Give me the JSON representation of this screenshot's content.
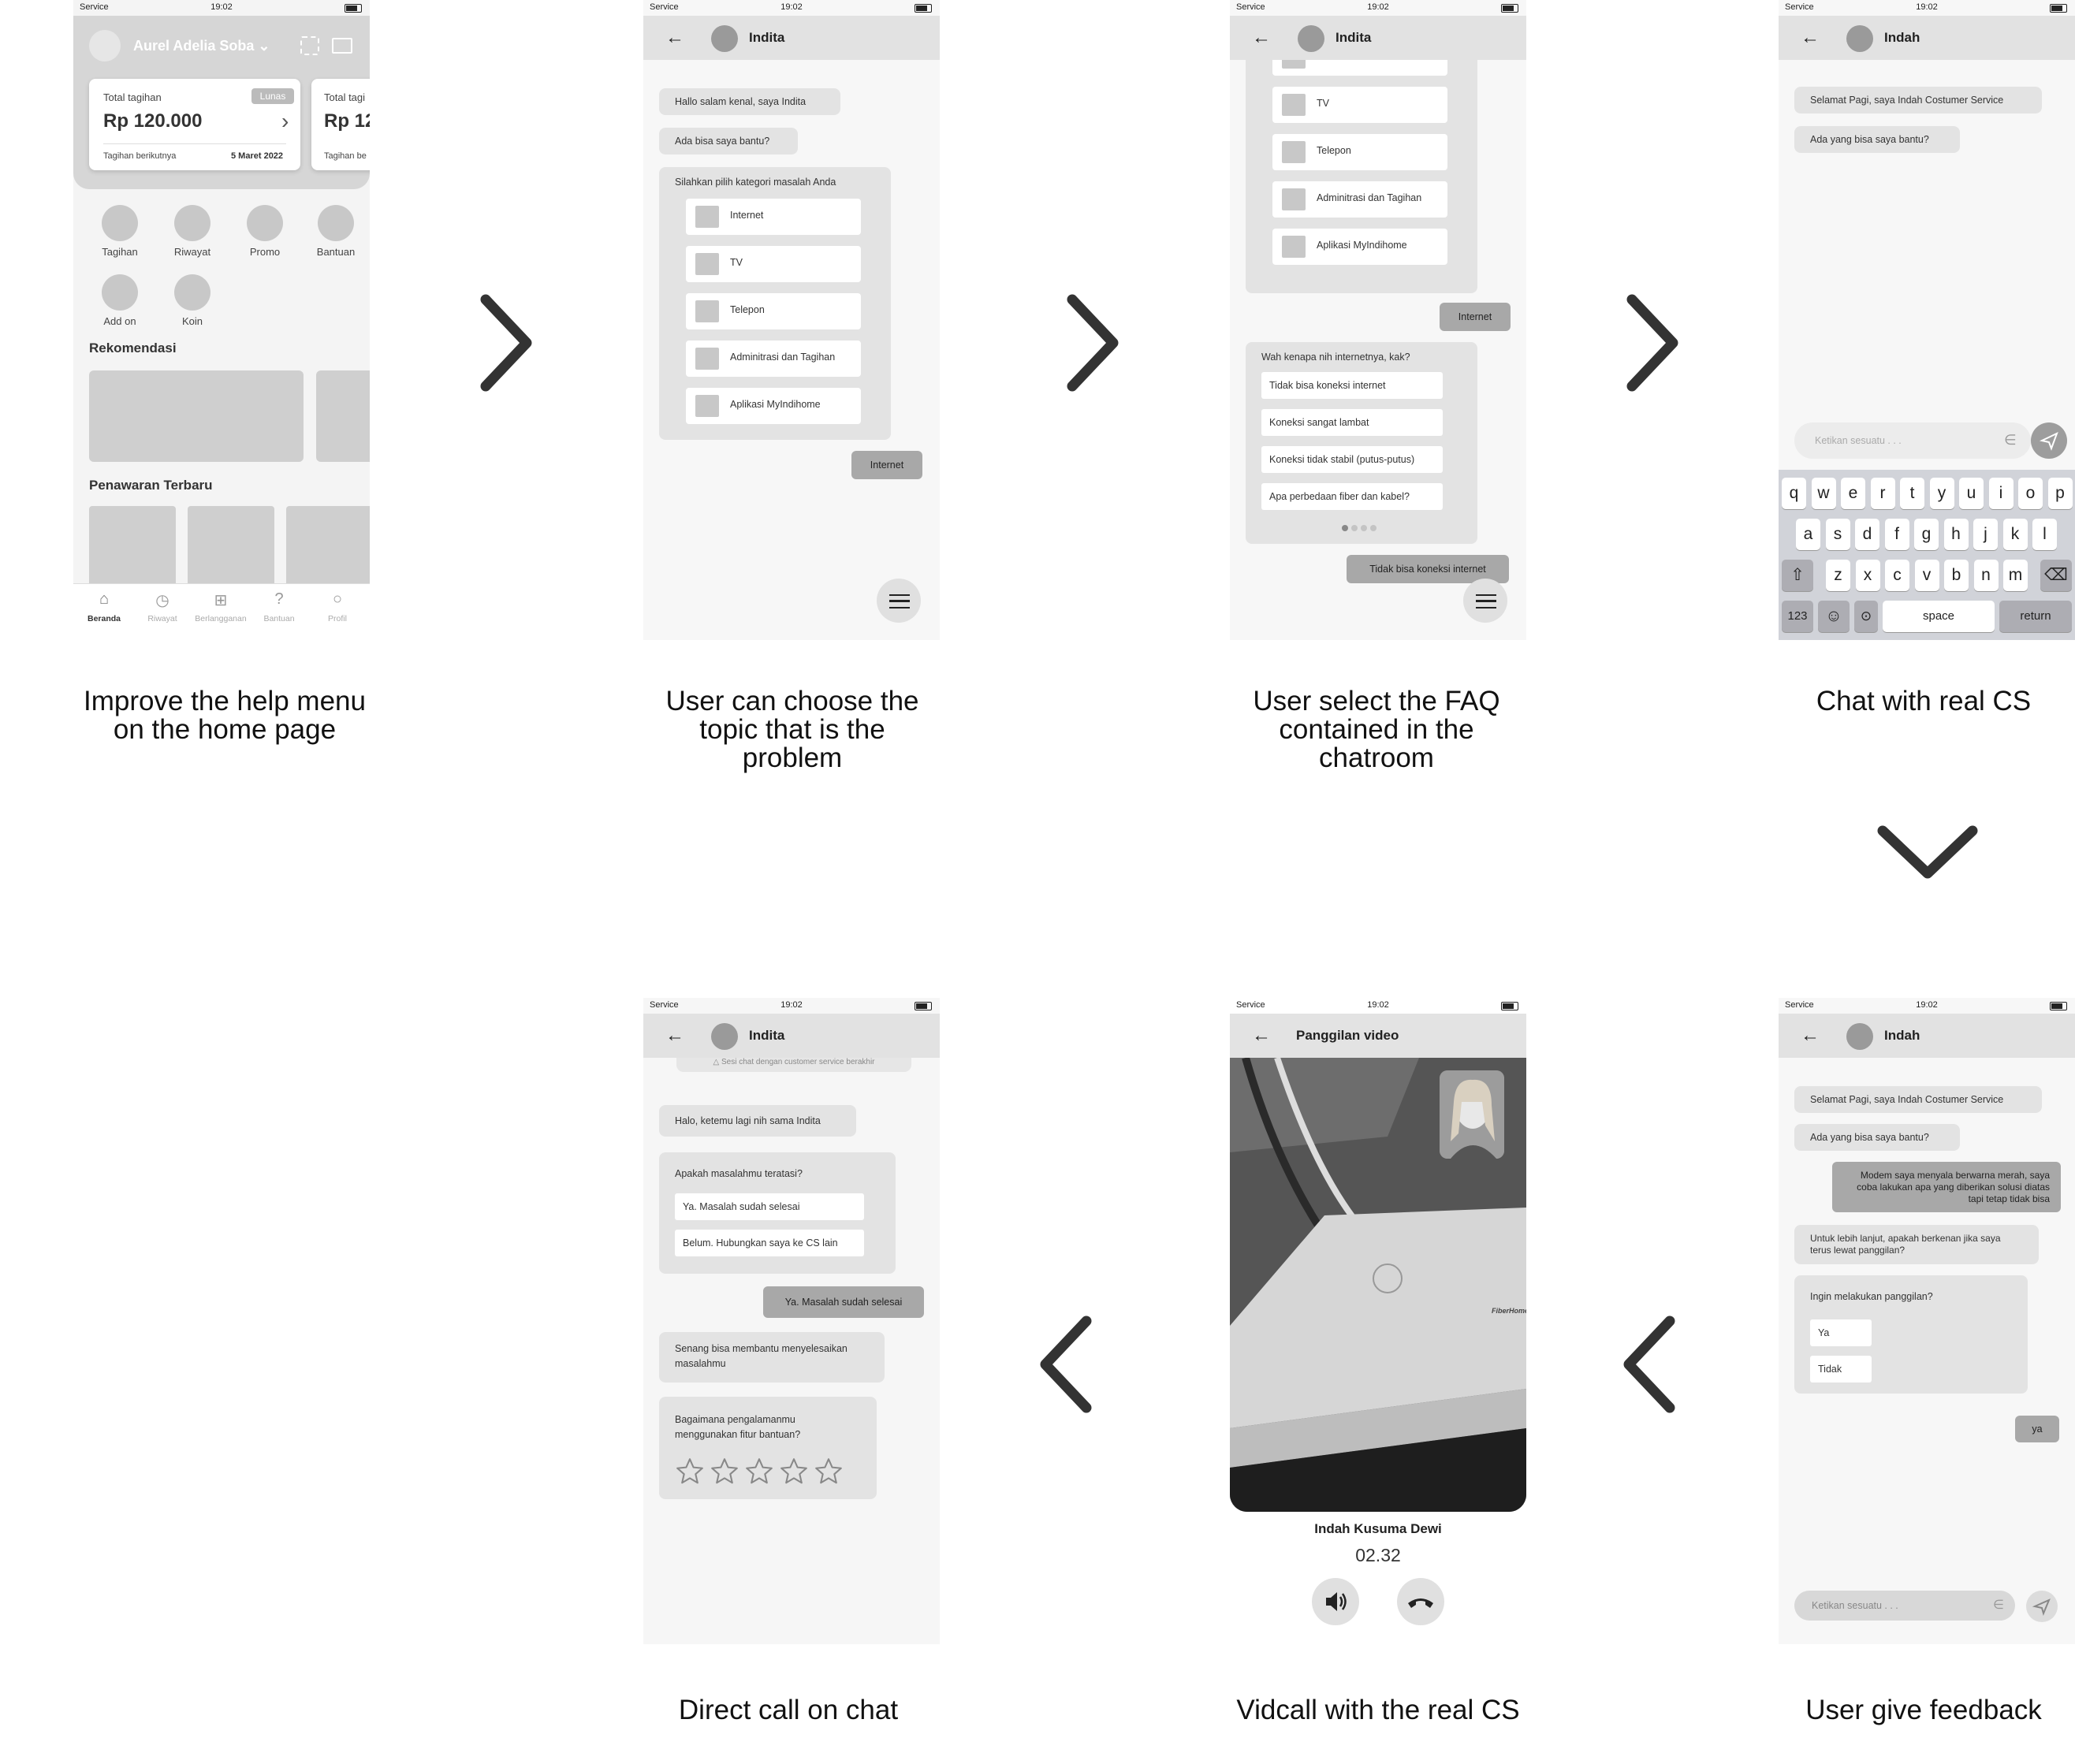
{
  "status": {
    "carrier": "Service",
    "time": "19:02"
  },
  "captions": {
    "s1": "Improve the help menu on the home page",
    "s2": "User can choose the topic that is the problem",
    "s3": "User select the FAQ contained in the chatroom",
    "s4": "Chat with real CS",
    "s5": "Direct call on chat",
    "s6": "Vidcall with the real CS",
    "s7": "User give feedback"
  },
  "home": {
    "user_name": "Aurel Adelia Soba",
    "card_label": "Total tagihan",
    "card_badge": "Lunas",
    "card_amount": "Rp 120.000",
    "card_next_label": "Tagihan berikutnya",
    "card_next_date": "5 Maret 2022",
    "card2_label": "Total tagi",
    "card2_amount": "Rp 12",
    "card2_next": "Tagihan be",
    "menu": [
      "Tagihan",
      "Riwayat",
      "Promo",
      "Bantuan",
      "Add on",
      "Koin"
    ],
    "section_reco": "Rekomendasi",
    "section_offer": "Penawaran Terbaru",
    "nav": [
      "Beranda",
      "Riwayat",
      "Berlangganan",
      "Bantuan",
      "Profil"
    ]
  },
  "chat_indita": {
    "agent": "Indita",
    "greet": "Hallo salam kenal, saya Indita",
    "ask": "Ada bisa saya bantu?",
    "category_prompt": "Silahkan pilih kategori masalah Anda",
    "categories": [
      "Internet",
      "TV",
      "Telepon",
      "Adminitrasi dan Tagihan",
      "Aplikasi MyIndihome"
    ],
    "user_pick": "Internet"
  },
  "chat_faq": {
    "agent": "Indita",
    "categories": [
      "Internet",
      "TV",
      "Telepon",
      "Adminitrasi dan Tagihan",
      "Aplikasi MyIndihome"
    ],
    "user_pick": "Internet",
    "faq_prompt": "Wah kenapa nih internetnya, kak?",
    "faqs": [
      "Tidak bisa koneksi internet",
      "Koneksi sangat lambat",
      "Koneksi tidak stabil (putus-putus)",
      "Apa perbedaan fiber dan kabel?"
    ],
    "user_faq": "Tidak bisa koneksi internet"
  },
  "chat_cs": {
    "agent": "Indah",
    "greet": "Selamat Pagi, saya Indah Costumer Service",
    "ask": "Ada yang bisa saya bantu?",
    "input_placeholder": "Ketikan sesuatu . . .",
    "row1": [
      "q",
      "w",
      "e",
      "r",
      "t",
      "y",
      "u",
      "i",
      "o",
      "p"
    ],
    "row2": [
      "a",
      "s",
      "d",
      "f",
      "g",
      "h",
      "j",
      "k",
      "l"
    ],
    "row3": [
      "z",
      "x",
      "c",
      "v",
      "b",
      "n",
      "m"
    ],
    "key_123": "123",
    "key_space": "space",
    "key_return": "return"
  },
  "chat_call": {
    "agent": "Indah",
    "greet": "Selamat Pagi, saya Indah Costumer Service",
    "ask": "Ada yang bisa saya bantu?",
    "user_msg": "Modem saya menyala berwarna merah, saya coba lakukan apa yang diberikan solusi diatas tapi tetap tidak bisa",
    "cs_msg": "Untuk lebih lanjut, apakah berkenan jika saya terus lewat panggilan?",
    "call_prompt": "Ingin melakukan panggilan?",
    "opt_yes": "Ya",
    "opt_no": "Tidak",
    "user_reply": "ya",
    "input_placeholder": "Ketikan sesuatu . . ."
  },
  "vidcall": {
    "title": "Panggilan video",
    "caller": "Indah Kusuma Dewi",
    "duration": "02.32",
    "brand_text": "FiberHome"
  },
  "feedback": {
    "agent": "Indita",
    "ended": "Sesi chat dengan customer service berakhir",
    "greet": "Halo, ketemu lagi nih sama Indita",
    "solved_q": "Apakah masalahmu teratasi?",
    "opt_yes": "Ya. Masalah sudah selesai",
    "opt_no": "Belum. Hubungkan saya ke CS lain",
    "user_reply": "Ya. Masalah sudah selesai",
    "thanks": "Senang bisa membantu menyelesaikan masalahmu",
    "rating_q": "Bagaimana pengalamanmu menggunakan fitur bantuan?",
    "rating_stars": 5
  }
}
